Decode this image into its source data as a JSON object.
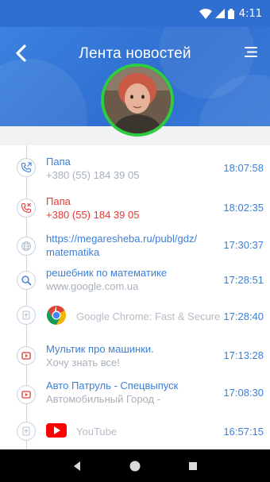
{
  "status_bar": {
    "time": "4:11"
  },
  "header": {
    "title": "Лента новостей"
  },
  "colors": {
    "accent": "#3e7fd6",
    "header_blue": "#2f6fd0",
    "alert_red": "#e53935",
    "avatar_ring": "#2ecc40",
    "muted": "#a8b0bb"
  },
  "feed": [
    {
      "type": "call",
      "icon": "phone-outgoing-icon",
      "title": "Папа",
      "subtitle": "+380 (55) 184 39 05",
      "time": "18:07:58",
      "alert": false
    },
    {
      "type": "call",
      "icon": "phone-missed-icon",
      "title": "Папа",
      "subtitle": "+380 (55) 184 39 05",
      "time": "18:02:35",
      "alert": true
    },
    {
      "type": "web",
      "icon": "globe-icon",
      "title": "https://megaresheba.ru/publ/gdz/",
      "subtitle": "matematika",
      "time": "17:30:37"
    },
    {
      "type": "search",
      "icon": "search-icon",
      "title": "решебник по математике",
      "subtitle": "www.google.com.ua",
      "time": "17:28:51"
    },
    {
      "type": "app",
      "icon": "app-install-icon",
      "app_icon": "chrome-icon",
      "title": "Google Chrome: Fast & Secure",
      "time": "17:28:40"
    },
    {
      "type": "video",
      "icon": "video-play-icon",
      "title": "Мультик про машинки.",
      "subtitle": "Хочу знать все!",
      "time": "17:13:28"
    },
    {
      "type": "video",
      "icon": "video-play-icon",
      "title": "Авто Патруль - Спецвыпуск",
      "subtitle": "Автомобильный Город -",
      "time": "17:08:30"
    },
    {
      "type": "app",
      "icon": "app-install-icon",
      "app_icon": "youtube-icon",
      "title": "YouTube",
      "time": "16:57:15"
    }
  ]
}
